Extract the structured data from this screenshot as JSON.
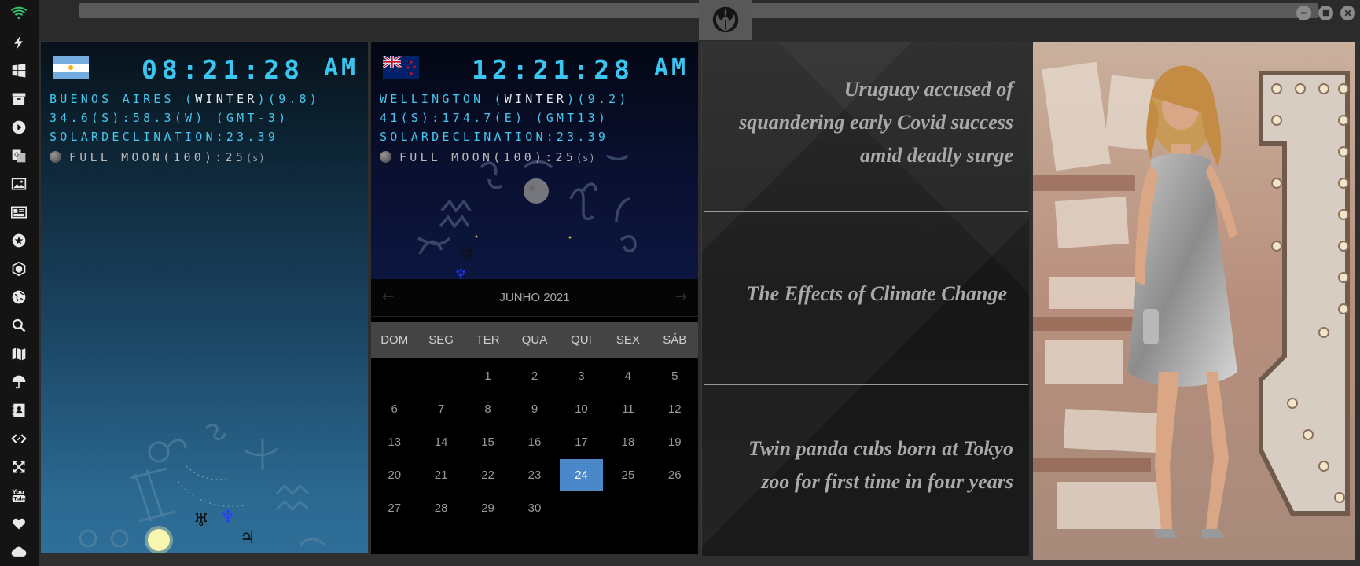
{
  "rail": {
    "icons": [
      "wifi-icon",
      "bolt-icon",
      "windows-icon",
      "archive-icon",
      "play-icon",
      "translate-icon",
      "image-icon",
      "newspaper-icon",
      "rebel-icon",
      "hexagon-icon",
      "globe-icon",
      "search-icon",
      "map-icon",
      "umbrella-icon",
      "contacts-icon",
      "code-icon",
      "expand-icon",
      "youtube-icon",
      "heart-icon",
      "cloud-icon"
    ]
  },
  "colors": {
    "accent_digits": "#3ac6f0",
    "calendar_selected": "#4a88c9",
    "headline": "#a9a9a9"
  },
  "clocks": [
    {
      "id": "buenos-aires",
      "flag": "argentina-flag",
      "time": "08:21:28",
      "ampm": "AM",
      "line1_pre": "BUENOS AIRES (",
      "line1_season": "WINTER",
      "line1_post": ")(9.8)",
      "line2": "34.6(S):58.3(W) (GMT-3)",
      "line3": "SOLARDECLINATION:23.39",
      "moon": "FULL MOON(100):25",
      "moon_suffix": "(s)"
    },
    {
      "id": "wellington",
      "flag": "new-zealand-flag",
      "time": "12:21:28",
      "ampm": "AM",
      "line1_pre": "WELLINGTON (",
      "line1_season": "WINTER",
      "line1_post": ")(9.2)",
      "line2": "41(S):174.7(E) (GMT13)",
      "line3": "SOLARDECLINATION:23.39",
      "moon": "FULL MOON(100):25",
      "moon_suffix": "(s)"
    }
  ],
  "calendar": {
    "title": "JUNHO 2021",
    "prev": "←",
    "next": "→",
    "weekdays": [
      "DOM",
      "SEG",
      "TER",
      "QUA",
      "QUI",
      "SEX",
      "SÁB"
    ],
    "leading_blanks": 2,
    "days": [
      "1",
      "2",
      "3",
      "4",
      "5",
      "6",
      "7",
      "8",
      "9",
      "10",
      "11",
      "12",
      "13",
      "14",
      "15",
      "16",
      "17",
      "18",
      "19",
      "20",
      "21",
      "22",
      "23",
      "24",
      "25",
      "26",
      "27",
      "28",
      "29",
      "30"
    ],
    "selected": "24"
  },
  "news": {
    "headlines": [
      {
        "lines": [
          "Uruguay accused of",
          "squandering early Covid success",
          "amid deadly surge"
        ]
      },
      {
        "lines": [
          "The Effects of Climate Change"
        ]
      },
      {
        "lines": [
          "Twin panda cubs born at Tokyo",
          "zoo for first time in four years"
        ]
      }
    ]
  },
  "planets": {
    "ba": {
      "uranus": "♅",
      "neptune": "♆",
      "jupiter": "♃"
    },
    "wel": {
      "jupiter": "♃",
      "neptune": "♆"
    }
  }
}
